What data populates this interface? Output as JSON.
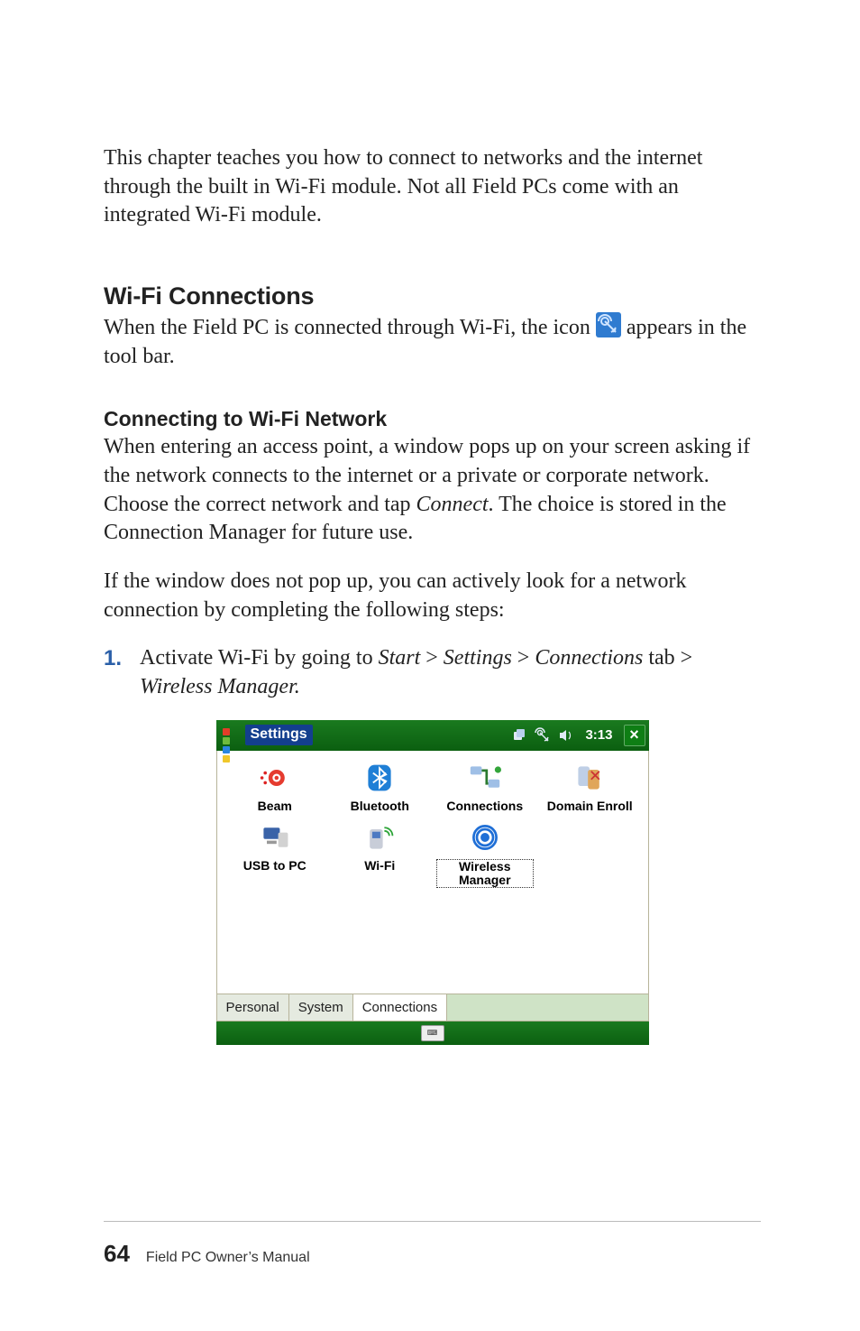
{
  "intro": "This chapter teaches you how to connect to networks and the internet through the built in Wi-Fi module. Not all Field PCs come with an integrated Wi-Fi module.",
  "section_heading": "Wi-Fi Connections",
  "wifi_line_pre": "When the Field PC is connected through Wi-Fi, the icon ",
  "wifi_line_post": " appears in the tool bar.",
  "sub_heading": "Connecting to Wi-Fi Network",
  "para_a_1": "When entering an access point, a window pops up on your screen asking if the network connects to the internet or a private or corporate network. Choose the correct network and tap ",
  "para_a_connect": "Connect",
  "para_a_2": ". The choice is stored in the Connection Manager for future use.",
  "para_b": "If the window does not pop up, you can actively look for a network connection by completing the following steps:",
  "step1": {
    "num": "1.",
    "t1": "Activate Wi-Fi by going to ",
    "start": "Start",
    "gt1": " > ",
    "settings": "Settings",
    "gt2": " > ",
    "connections": "Connections",
    "tab": " tab ",
    "gt3": "> ",
    "wm": "Wireless Manager."
  },
  "shot": {
    "title": "Settings",
    "time": "3:13",
    "close": "×",
    "items": {
      "beam": "Beam",
      "bluetooth": "Bluetooth",
      "connections": "Connections",
      "domain": "Domain Enroll",
      "usb": "USB to PC",
      "wifi": "Wi-Fi",
      "wireless": "Wireless Manager"
    },
    "tabs": {
      "personal": "Personal",
      "system": "System",
      "connections": "Connections"
    }
  },
  "footer": {
    "page": "64",
    "title": "Field PC Owner’s Manual"
  }
}
